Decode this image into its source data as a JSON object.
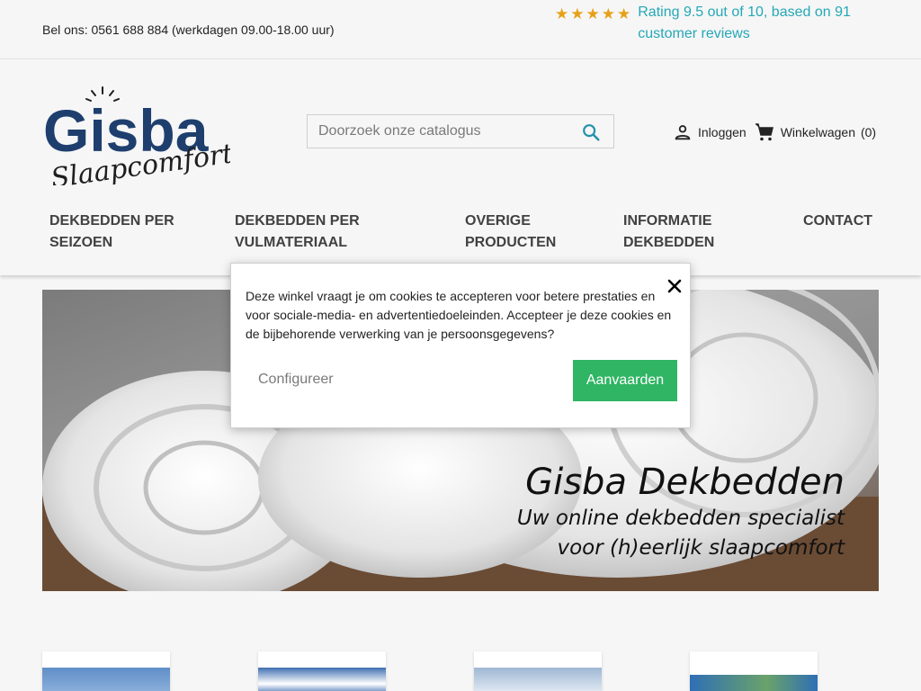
{
  "topbar": {
    "phone": "Bel ons: 0561 688 884 (werkdagen 09.00-18.00 uur)",
    "stars": [
      "★",
      "★",
      "★",
      "★",
      "★"
    ],
    "rating_text": "Rating 9.5 out of 10, based on 91 customer reviews"
  },
  "logo": {
    "brand": "Gisba",
    "tagline": "Slaapcomfort"
  },
  "search": {
    "placeholder": "Doorzoek onze catalogus"
  },
  "user": {
    "login": "Inloggen",
    "cart": "Winkelwagen",
    "cart_count": "(0)"
  },
  "nav": [
    {
      "line1": "DEKBEDDEN PER",
      "line2": "SEIZOEN"
    },
    {
      "line1": "DEKBEDDEN PER",
      "line2": "VULMATERIAAL"
    },
    {
      "line1": "OVERIGE",
      "line2": "PRODUCTEN"
    },
    {
      "line1": "INFORMATIE",
      "line2": "DEKBEDDEN"
    },
    {
      "line1": "CONTACT",
      "line2": ""
    }
  ],
  "hero": {
    "title": "Gisba Dekbedden",
    "sub1": "Uw online dekbedden specialist",
    "sub2": "voor (h)eerlijk slaapcomfort"
  },
  "cookie": {
    "text": "Deze winkel vraagt je om cookies te accepteren voor betere prestaties en voor sociale-media- en advertentiedoeleinden. Accepteer je deze cookies en de bijbehorende verwerking van je persoonsgegevens?",
    "configure": "Configureer",
    "accept": "Aanvaarden"
  },
  "colors": {
    "accent": "#24a8b7",
    "accept": "#2fb563",
    "star": "#e6a117",
    "logo_blue": "#1e3f6e"
  }
}
